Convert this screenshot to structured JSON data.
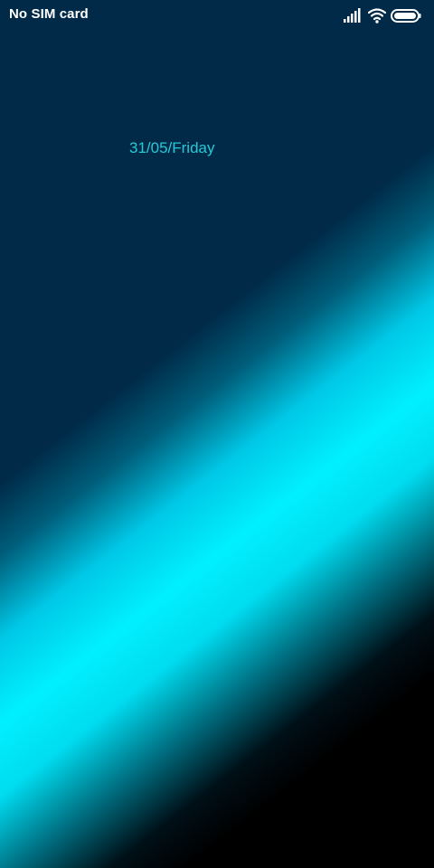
{
  "status_bar": {
    "carrier": "No SIM card",
    "icons": [
      "signal-icon",
      "wifi-icon",
      "battery-icon"
    ]
  },
  "lock_screen": {
    "date": "31/05/Friday"
  },
  "colors": {
    "background": "#002a47",
    "accent": "#00f0ff",
    "date_text": "#25c9d8"
  }
}
